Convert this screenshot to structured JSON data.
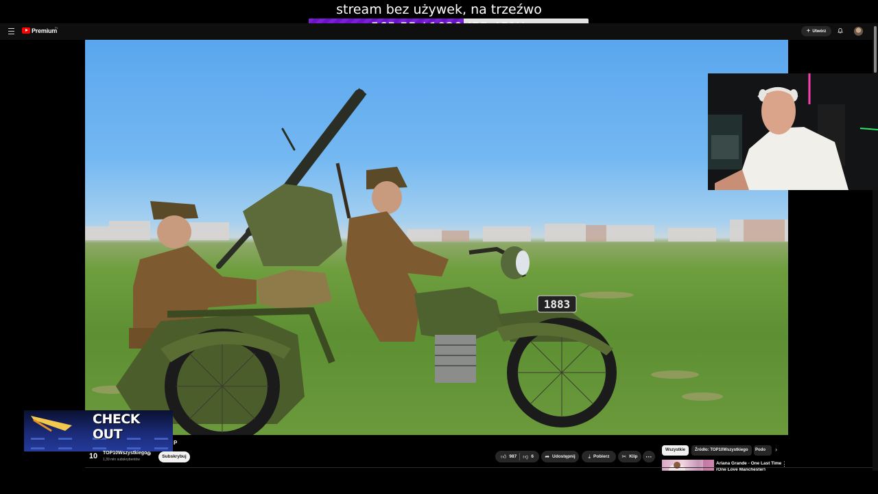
{
  "stream": {
    "title": "stream bez używek, na trzeźwo",
    "progress_text": "565.55 / 1020 (55.45%)",
    "progress_fraction": 0.5545
  },
  "topbar": {
    "logo_text": "Premium",
    "logo_sup": "PL",
    "create_label": "Utwórz"
  },
  "video": {
    "plate_text": "1883"
  },
  "promo": {
    "check_out_text": "CHECK OUT"
  },
  "title_fragment": "P",
  "channel": {
    "logo_text": "10",
    "name": "TOP10Wszystkiego",
    "subscribers": "1,39 mln subskrybentów",
    "subscribe_label": "Subskrybuj"
  },
  "actions": {
    "likes": "987",
    "dislikes": "6",
    "share_label": "Udostępnij",
    "download_label": "Pobierz",
    "clip_label": "Klip",
    "more_label": "···"
  },
  "chips": [
    {
      "label": "Wszystkie"
    },
    {
      "label": "Źródło: TOP10Wszystkiego"
    },
    {
      "label": "Podo"
    }
  ],
  "recommended": {
    "title": "Ariana Grande - One Last Time",
    "subtitle": "(One Love Manchester)"
  },
  "colors": {
    "progress_purple": "#7b1ed8",
    "youtube_red": "#ff0000",
    "page_bg": "#0f0f0f"
  }
}
